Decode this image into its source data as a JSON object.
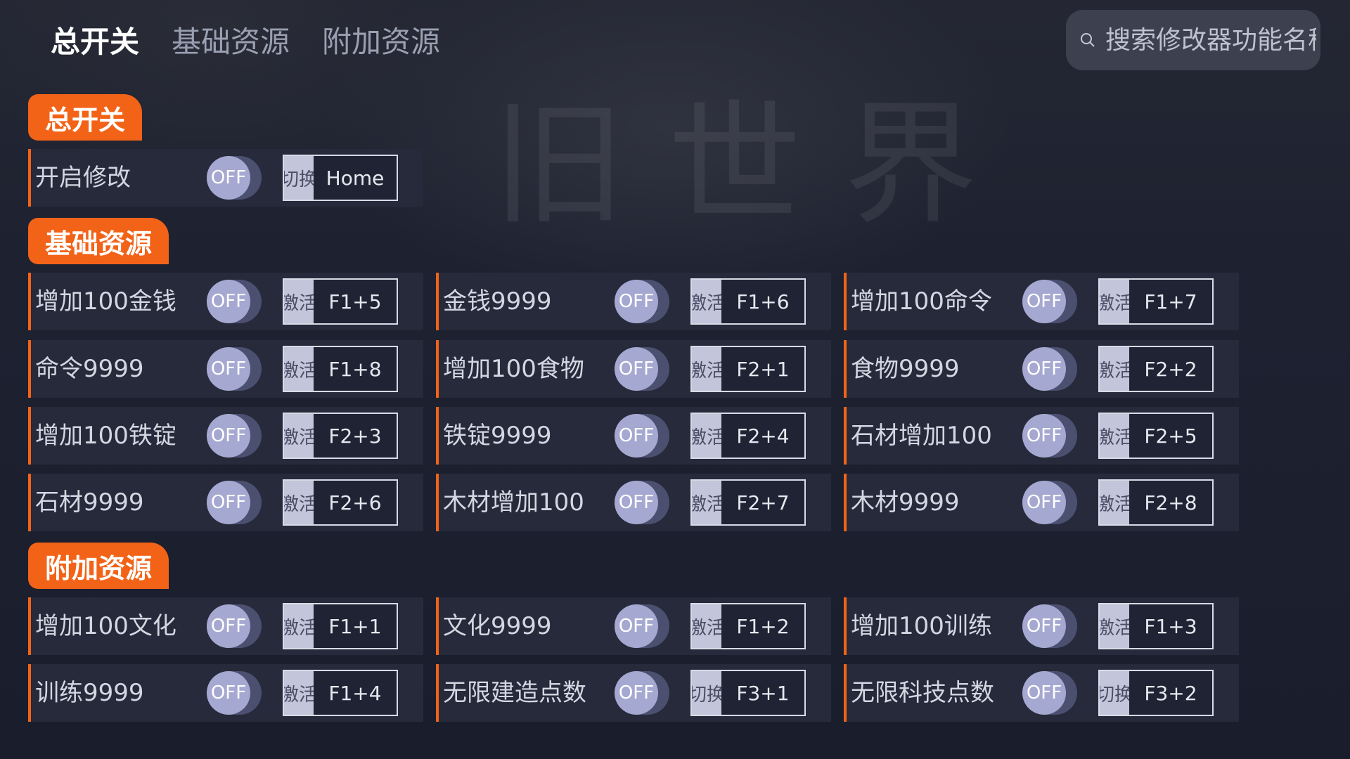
{
  "background": {
    "watermark_text": "旧世界"
  },
  "nav": {
    "tabs": [
      {
        "label": "总开关",
        "active": true
      },
      {
        "label": "基础资源",
        "active": false
      },
      {
        "label": "附加资源",
        "active": false
      }
    ]
  },
  "search": {
    "placeholder": "搜索修改器功能名称",
    "icon": "search-icon"
  },
  "colors": {
    "accent": "#f26318",
    "row_bg": "#262a3a",
    "toggle_knob": "#a5a8d0"
  },
  "sections": {
    "master": {
      "title": "总开关",
      "items": [
        {
          "label": "开启修改",
          "state": "OFF",
          "mode": "切换",
          "key": "Home"
        }
      ]
    },
    "basic": {
      "title": "基础资源",
      "items": [
        {
          "label": "增加100金钱",
          "state": "OFF",
          "mode": "激活",
          "key": "F1+5"
        },
        {
          "label": "金钱9999",
          "state": "OFF",
          "mode": "激活",
          "key": "F1+6"
        },
        {
          "label": "增加100命令",
          "state": "OFF",
          "mode": "激活",
          "key": "F1+7"
        },
        {
          "label": "命令9999",
          "state": "OFF",
          "mode": "激活",
          "key": "F1+8"
        },
        {
          "label": "增加100食物",
          "state": "OFF",
          "mode": "激活",
          "key": "F2+1"
        },
        {
          "label": "食物9999",
          "state": "OFF",
          "mode": "激活",
          "key": "F2+2"
        },
        {
          "label": "增加100铁锭",
          "state": "OFF",
          "mode": "激活",
          "key": "F2+3"
        },
        {
          "label": "铁锭9999",
          "state": "OFF",
          "mode": "激活",
          "key": "F2+4"
        },
        {
          "label": "石材增加100",
          "state": "OFF",
          "mode": "激活",
          "key": "F2+5"
        },
        {
          "label": "石材9999",
          "state": "OFF",
          "mode": "激活",
          "key": "F2+6"
        },
        {
          "label": "木材增加100",
          "state": "OFF",
          "mode": "激活",
          "key": "F2+7"
        },
        {
          "label": "木材9999",
          "state": "OFF",
          "mode": "激活",
          "key": "F2+8"
        }
      ]
    },
    "extra": {
      "title": "附加资源",
      "items": [
        {
          "label": "增加100文化",
          "state": "OFF",
          "mode": "激活",
          "key": "F1+1"
        },
        {
          "label": "文化9999",
          "state": "OFF",
          "mode": "激活",
          "key": "F1+2"
        },
        {
          "label": "增加100训练",
          "state": "OFF",
          "mode": "激活",
          "key": "F1+3"
        },
        {
          "label": "训练9999",
          "state": "OFF",
          "mode": "激活",
          "key": "F1+4"
        },
        {
          "label": "无限建造点数",
          "state": "OFF",
          "mode": "切换",
          "key": "F3+1"
        },
        {
          "label": "无限科技点数",
          "state": "OFF",
          "mode": "切换",
          "key": "F3+2"
        }
      ]
    }
  }
}
